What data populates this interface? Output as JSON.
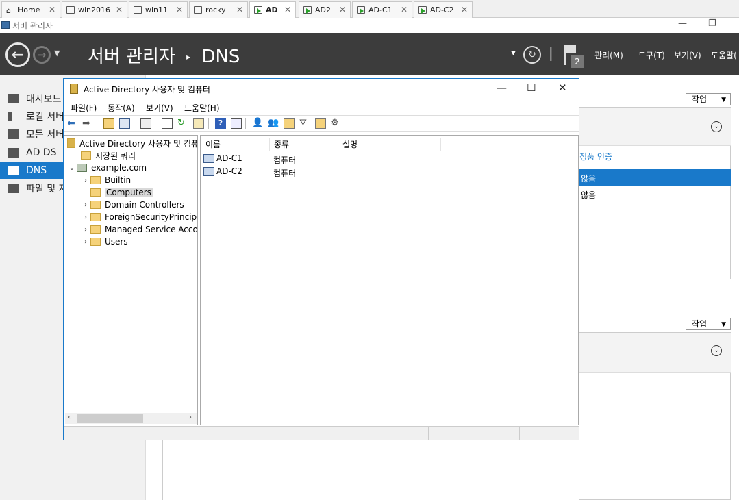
{
  "vm_tabs": [
    {
      "label": "Home",
      "icon": "home-icon"
    },
    {
      "label": "win2016",
      "icon": "vm-icon"
    },
    {
      "label": "win11",
      "icon": "vm-icon"
    },
    {
      "label": "rocky",
      "icon": "vm-icon"
    },
    {
      "label": "AD",
      "icon": "vm-running-icon",
      "active": true
    },
    {
      "label": "AD2",
      "icon": "vm-running-icon"
    },
    {
      "label": "AD-C1",
      "icon": "vm-running-icon"
    },
    {
      "label": "AD-C2",
      "icon": "vm-running-icon"
    }
  ],
  "server_manager": {
    "window_title": "서버 관리자",
    "header_title": "서버 관리자",
    "breadcrumb_sep": "▸",
    "breadcrumb_page": "DNS",
    "notification_count": "2",
    "menu": {
      "manage": "관리(M)",
      "tools": "도구(T)",
      "view": "보기(V)",
      "help": "도움말("
    },
    "sidebar": [
      {
        "label": "대시보드"
      },
      {
        "label": "로컬 서버"
      },
      {
        "label": "모든 서버"
      },
      {
        "label": "AD DS"
      },
      {
        "label": "DNS",
        "selected": true
      },
      {
        "label": "파일 및 저"
      }
    ],
    "tasks_label": "작업",
    "product_activation": "정품 인증",
    "row_values": [
      "않음",
      "않음"
    ]
  },
  "aduc": {
    "title": "Active Directory 사용자 및 컴퓨터",
    "menu": {
      "file": "파일(F)",
      "action": "동작(A)",
      "view": "보기(V)",
      "help": "도움말(H)"
    },
    "tree": {
      "root": "Active Directory 사용자 및 컴퓨",
      "saved_queries": "저장된 쿼리",
      "domain": "example.com",
      "children": [
        "Builtin",
        "Computers",
        "Domain Controllers",
        "ForeignSecurityPrincipal",
        "Managed Service Accou",
        "Users"
      ]
    },
    "columns": [
      "이름",
      "종류",
      "설명"
    ],
    "rows": [
      {
        "name": "AD-C1",
        "type": "컴퓨터"
      },
      {
        "name": "AD-C2",
        "type": "컴퓨터"
      }
    ]
  },
  "colors": {
    "accent": "#1979ca",
    "header": "#3c3c3c"
  }
}
